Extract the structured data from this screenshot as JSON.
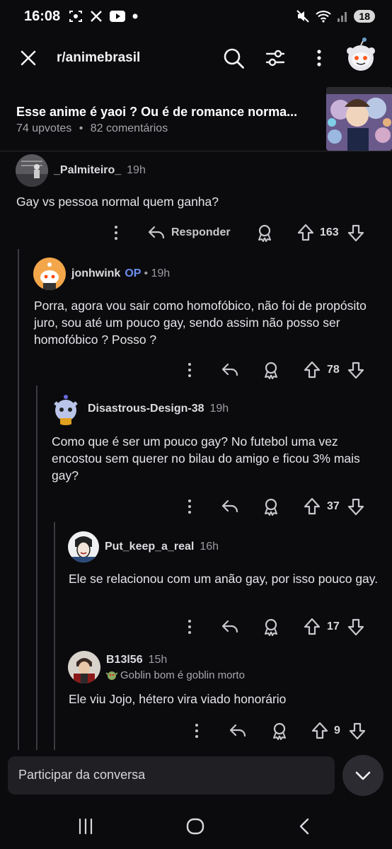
{
  "status": {
    "time": "16:08",
    "battery": "18"
  },
  "appbar": {
    "subreddit": "r/animebrasil"
  },
  "post": {
    "title": "Esse anime é yaoi ? Ou é de romance norma...",
    "upvotes": "74 upvotes",
    "separator": "•",
    "comments": "82 comentários"
  },
  "comments": [
    {
      "user": "_Palmiteiro_",
      "time": "19h",
      "body": "Gay vs pessoa normal quem ganha?",
      "votes": "163",
      "reply_label": "Responder"
    },
    {
      "user": "jonhwink",
      "op": "OP",
      "time": "• 19h",
      "body": "Porra, agora vou sair como homofóbico, não foi de propósito juro, sou até um pouco gay, sendo assim não posso ser homofóbico ? Posso ?",
      "votes": "78"
    },
    {
      "user": "Disastrous-Design-38",
      "time": "19h",
      "body": "Como que é ser um pouco gay? No futebol uma vez encostou sem querer no bilau do amigo e ficou 3% mais gay?",
      "votes": "37"
    },
    {
      "user": "Put_keep_a_real",
      "time": "16h",
      "body": "Ele se relacionou com um anão gay, por isso pouco gay.",
      "votes": "17"
    },
    {
      "user": "B13l56",
      "time": "15h",
      "flair": "Goblin bom é goblin morto",
      "body": "Ele viu Jojo, hétero vira viado honorário",
      "votes": "9"
    }
  ],
  "composer": {
    "placeholder": "Participar da conversa"
  },
  "colors": {
    "background": "#0b0b0e",
    "op_blue": "#6b8ff0",
    "composer": "#1f1f24"
  }
}
